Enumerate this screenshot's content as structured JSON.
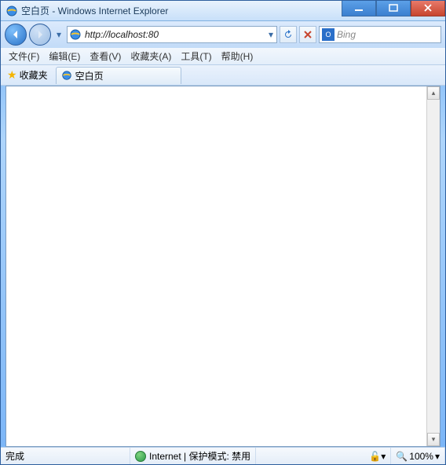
{
  "titlebar": {
    "title": "空白页 - Windows Internet Explorer"
  },
  "nav": {
    "url": "http://localhost:80",
    "search_placeholder": "Bing"
  },
  "menu": {
    "file": "文件(F)",
    "edit": "编辑(E)",
    "view": "查看(V)",
    "favorites": "收藏夹(A)",
    "tools": "工具(T)",
    "help": "帮助(H)"
  },
  "favbar": {
    "fav_label": "收藏夹",
    "tab_title": "空白页"
  },
  "status": {
    "done": "完成",
    "zone": "Internet | 保护模式: 禁用",
    "zoom": "100%"
  }
}
